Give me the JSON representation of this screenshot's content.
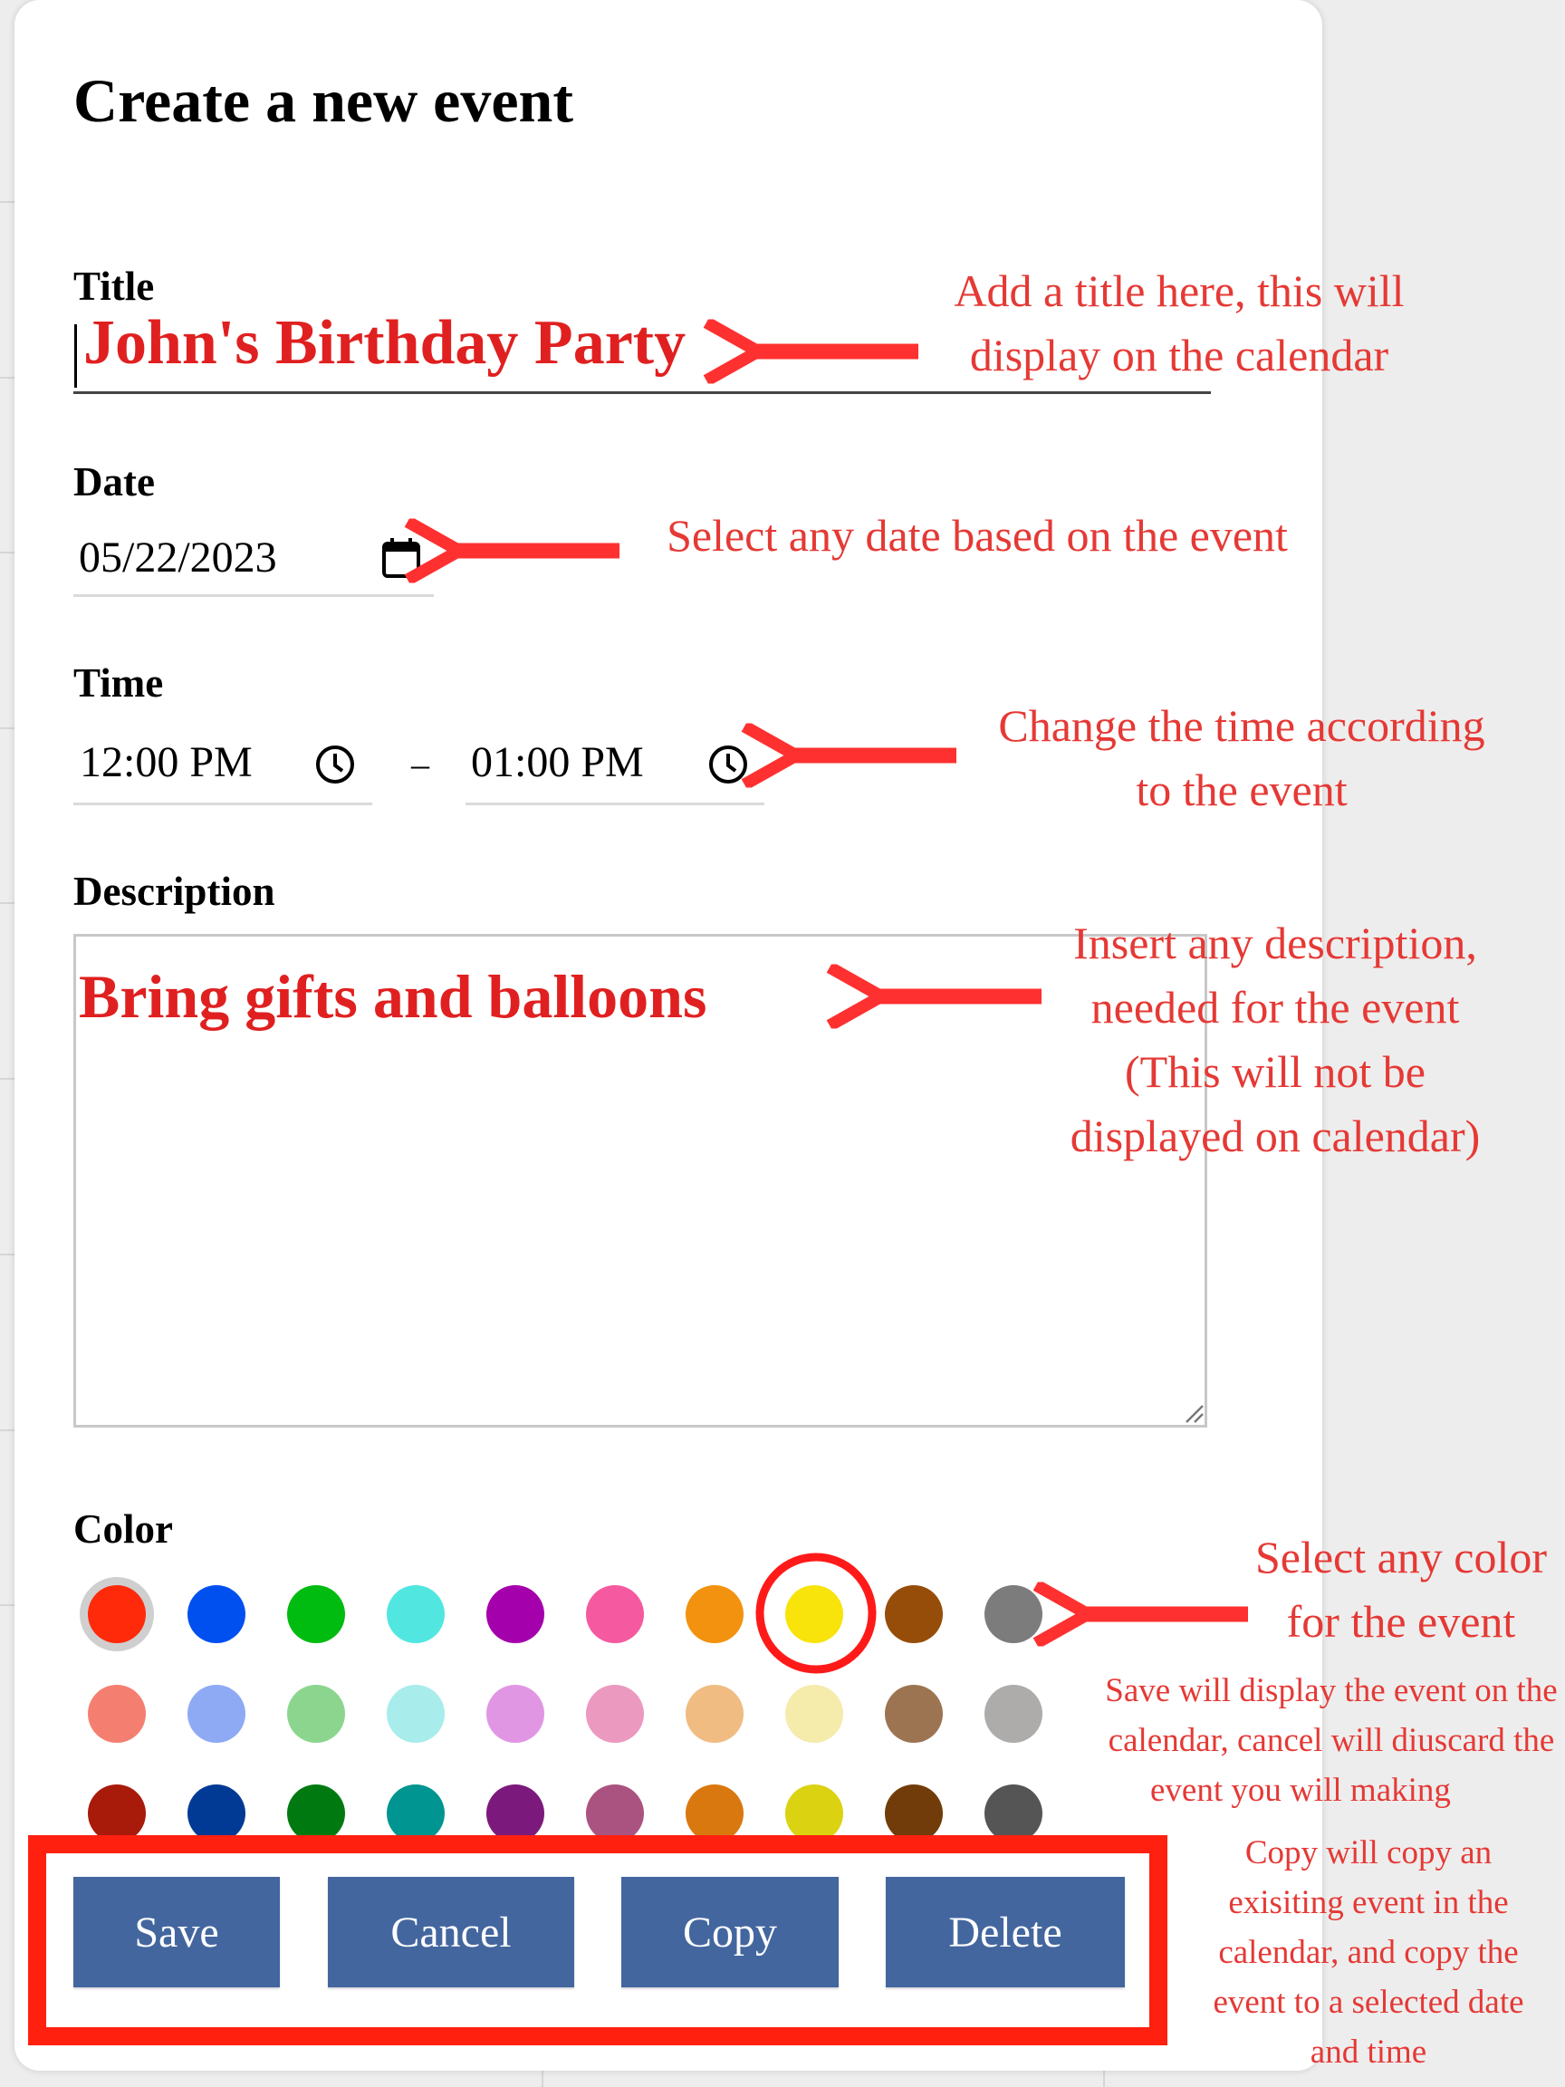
{
  "form": {
    "heading": "Create a new event",
    "title_label": "Title",
    "title_value": "John's Birthday Party",
    "date_label": "Date",
    "date_value": "05/22/2023",
    "time_label": "Time",
    "time_start": "12:00 PM",
    "time_separator": "–",
    "time_end": "01:00 PM",
    "description_label": "Description",
    "description_value": "Bring gifts and balloons",
    "color_label": "Color",
    "selected_color": "#ff2a0a",
    "color_rows": [
      [
        "#ff2a0a",
        "#0050f0",
        "#00bb10",
        "#52e6e0",
        "#a400ac",
        "#f55aa0",
        "#f3920f",
        "#f8e30b",
        "#964d0a",
        "#7c7c7c"
      ],
      [
        "#f47f70",
        "#8eaaf5",
        "#8cd58f",
        "#a8ecec",
        "#e196e4",
        "#ec99c0",
        "#f0bc82",
        "#f5ebaa",
        "#9c7452",
        "#aeacaa"
      ],
      [
        "#a81a0a",
        "#003a94",
        "#007a10",
        "#009590",
        "#7c197c",
        "#ab5380",
        "#d9780f",
        "#dbd212",
        "#713c0a",
        "#555555"
      ]
    ],
    "buttons": {
      "save": "Save",
      "cancel": "Cancel",
      "copy": "Copy",
      "delete": "Delete"
    }
  },
  "annotations": {
    "title_note": [
      "Add a title here, this will",
      "display on the calendar"
    ],
    "date_note": [
      "Select any date based on the event"
    ],
    "time_note": [
      "Change the time according",
      "to the event"
    ],
    "description_note": [
      "Insert any description,",
      "needed for the event",
      "(This will not be",
      "displayed on calendar)"
    ],
    "color_note": [
      "Select any color",
      "for the event"
    ],
    "save_cancel_note": [
      "Save will display the event on the",
      "calendar, cancel will diuscard the",
      "event you will making"
    ],
    "copy_note": [
      "Copy will copy an",
      "exisiting event in the",
      "calendar, and copy the",
      "event to a selected date",
      "and time"
    ],
    "accent_color": "#e53935"
  }
}
